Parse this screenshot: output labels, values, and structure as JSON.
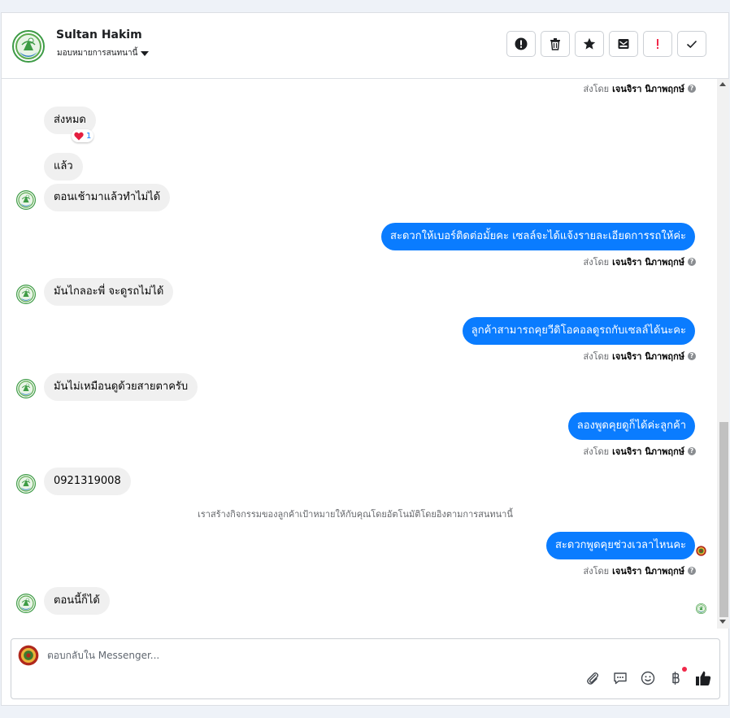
{
  "contact": {
    "name": "Sultan Hakim",
    "assign_label": "มอบหมายการสนทนานี้"
  },
  "header_actions": [
    {
      "name": "report-spam",
      "icon": "alert-circle-icon"
    },
    {
      "name": "delete",
      "icon": "trash-icon"
    },
    {
      "name": "star",
      "icon": "star-icon"
    },
    {
      "name": "move-to-inbox",
      "icon": "inbox-icon"
    },
    {
      "name": "follow-up",
      "icon": "exclamation-icon"
    },
    {
      "name": "mark-done",
      "icon": "checkmark-icon"
    }
  ],
  "sent_by": {
    "prefix": "ส่งโดย",
    "agent": "เจนจิรา นิภาพฤกษ์"
  },
  "messages": [
    {
      "id": "m1",
      "direction": "in",
      "text": "ส่งหมด",
      "reaction": {
        "emoji": "❤️",
        "count": "1"
      }
    },
    {
      "id": "m2",
      "direction": "in",
      "text": "แล้ว"
    },
    {
      "id": "m3",
      "direction": "in",
      "text": "ตอนเช้ามาแล้วทำไม่ได้"
    },
    {
      "id": "m4",
      "direction": "out",
      "text": "สะดวกให้เบอร์ติดต่อมั้ยคะ เซลล์จะได้แจ้งรายละเอียดการรถให้ค่ะ"
    },
    {
      "id": "m5",
      "direction": "in",
      "text": "มันไกลอะพี่ จะดูรถไม่ได้"
    },
    {
      "id": "m6",
      "direction": "out",
      "text": "ลูกค้าสามารถคุยวีดิโอคอลดูรถกับเซลล์ได้นะคะ"
    },
    {
      "id": "m7",
      "direction": "in",
      "text": "มันไม่เหมือนดูด้วยสายตาครับ"
    },
    {
      "id": "m8",
      "direction": "out",
      "text": "ลองพูดคุยดูก็ได้ค่ะลูกค้า"
    },
    {
      "id": "m9",
      "direction": "in",
      "text": "0921319008"
    },
    {
      "id": "m10",
      "direction": "out",
      "text": "สะดวกพูดคุยช่วงเวลาไหนคะ"
    },
    {
      "id": "m11",
      "direction": "in",
      "text": "ตอนนี้ก็ได้"
    }
  ],
  "system_note": "เราสร้างกิจกรรมของลูกค้าเป้าหมายให้กับคุณโดยอัตโนมัติโดยอิงตามการสนทนานี้",
  "composer": {
    "placeholder": "ตอบกลับใน Messenger...",
    "value": "",
    "tools": [
      "attach-icon",
      "saved-reply-icon",
      "emoji-icon",
      "payment-baht-icon",
      "like-thumb-icon"
    ]
  },
  "colors": {
    "outgoing_bubble": "#0a7cff",
    "incoming_bubble": "#f0f0f0",
    "follow_up": "#f02849",
    "brand_green": "#3d9b45"
  }
}
